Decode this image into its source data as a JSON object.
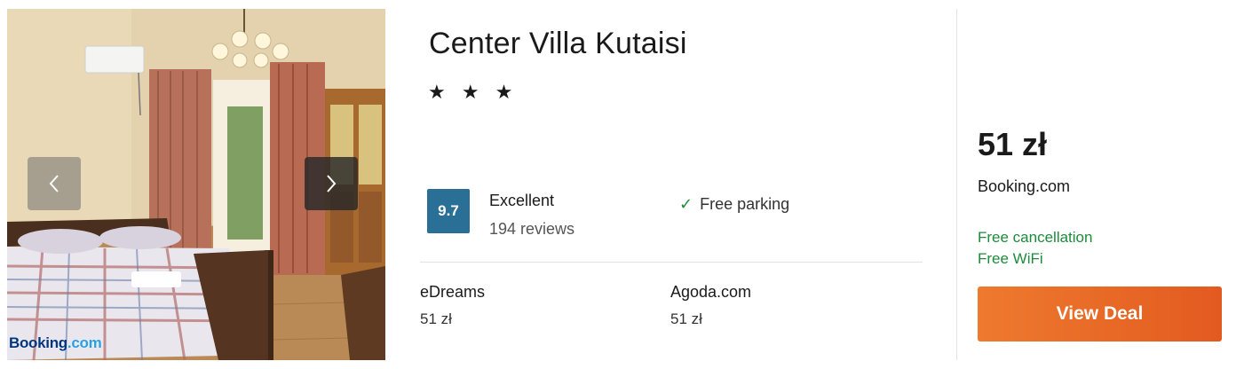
{
  "hotel": {
    "name": "Center Villa Kutaisi",
    "stars_text": "★ ★ ★",
    "star_count": 3
  },
  "photo": {
    "source_brand_prefix": "Booking",
    "source_brand_dot": ".",
    "source_brand_suffix": "com",
    "prev_icon": "chevron-left-icon",
    "next_icon": "chevron-right-icon"
  },
  "rating": {
    "score": "9.7",
    "label": "Excellent",
    "reviews": "194 reviews"
  },
  "amenity": {
    "icon": "checkmark-icon",
    "check_glyph": "✓",
    "label": "Free parking"
  },
  "partners": [
    {
      "name": "eDreams",
      "price": "51 zł"
    },
    {
      "name": "Agoda.com",
      "price": "51 zł"
    }
  ],
  "deal": {
    "price": "51 zł",
    "provider": "Booking.com",
    "perks": [
      "Free cancellation",
      "Free WiFi"
    ],
    "button_label": "View Deal"
  },
  "colors": {
    "score_badge": "#2a6f96",
    "perk_green": "#1e8a3c",
    "deal_button": "#e8652a"
  }
}
